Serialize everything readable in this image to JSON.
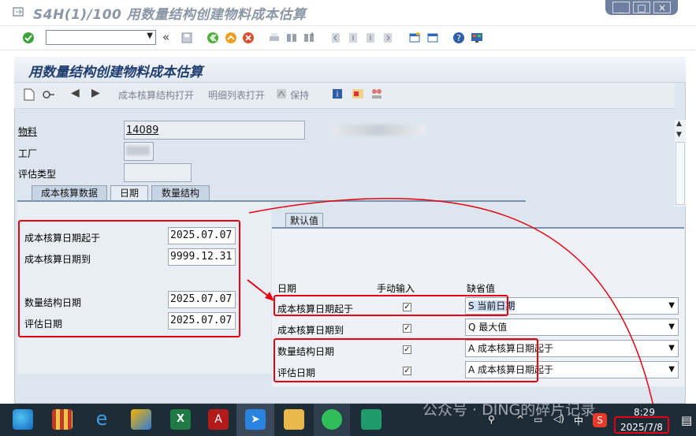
{
  "window": {
    "title": "S4H(1)/100 用数量结构创建物料成本估算"
  },
  "screen": {
    "title": "用数量结构创建物料成本估算"
  },
  "app_toolbar": {
    "open_structure": "成本核算结构打开",
    "open_detail": "明细列表打开",
    "hold": "保持"
  },
  "header": {
    "material_label": "物料",
    "material_value": "14089",
    "plant_label": "工厂",
    "valuation_label": "评估类型"
  },
  "tabs": [
    {
      "label": "成本核算数据"
    },
    {
      "label": "日期"
    },
    {
      "label": "数量结构"
    }
  ],
  "dates": {
    "costing_from_label": "成本核算日期起于",
    "costing_from_value": "2025.07.07",
    "costing_to_label": "成本核算日期到",
    "costing_to_value": "9999.12.31",
    "qty_date_label": "数量结构日期",
    "qty_date_value": "2025.07.07",
    "valuation_date_label": "评估日期",
    "valuation_date_value": "2025.07.07"
  },
  "defaults": {
    "tab_label": "默认值",
    "col_date": "日期",
    "col_manual": "手动输入",
    "col_default": "缺省值",
    "rows": [
      {
        "label": "成本核算日期起于",
        "checked": true,
        "value": "S 当前日期"
      },
      {
        "label": "成本核算日期到",
        "checked": true,
        "value": "Q 最大值"
      },
      {
        "label": "数量结构日期",
        "checked": true,
        "value": "A 成本核算日期起于"
      },
      {
        "label": "评估日期",
        "checked": true,
        "value": "A 成本核算日期起于"
      }
    ]
  },
  "taskbar": {
    "time": "8:29",
    "date": "2025/7/8",
    "ime": "中",
    "watermark": "公众号 · DING的碎片记录"
  },
  "colors": {
    "highlight": "#e60012",
    "title_blue": "#1e3c6e"
  }
}
